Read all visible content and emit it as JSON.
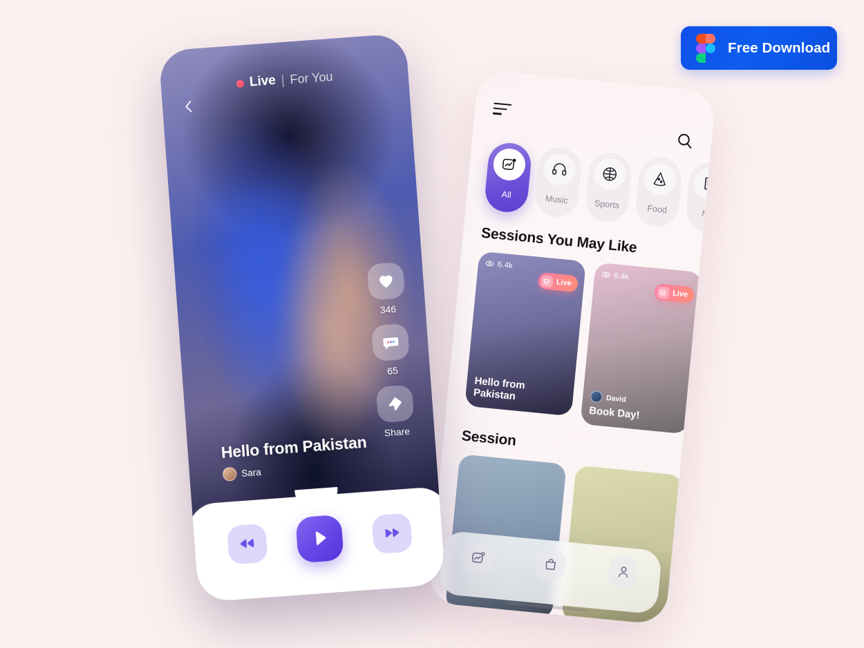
{
  "download": {
    "label": "Free Download",
    "icon": "figma-logo",
    "accent": "#1050e8"
  },
  "theme": {
    "background": "#fdf1f0",
    "purple": "#6546e6",
    "purple_light": "#dcd8fa",
    "live_pink": "#fb7fa6",
    "phone_header": "#8e8cbd"
  },
  "live_screen": {
    "back_icon": "chevron-left-icon",
    "status_dot": "live-dot",
    "title_live": "Live",
    "title_separator": "|",
    "title_feed": "For You",
    "actions": [
      {
        "icon": "heart-icon",
        "label": "346",
        "name": "like-action"
      },
      {
        "icon": "comment-icon",
        "label": "65",
        "name": "comment-action"
      },
      {
        "icon": "share-icon",
        "label": "Share",
        "name": "share-action"
      }
    ],
    "caption": "Hello from Pakistan",
    "user": "Sara",
    "player": {
      "rewind_icon": "rewind-icon",
      "play_icon": "play-icon",
      "forward_icon": "forward-icon"
    }
  },
  "home_screen": {
    "menu_icon": "hamburger-icon",
    "search_icon": "search-icon",
    "categories": [
      {
        "label": "All",
        "icon": "photo-chart-icon",
        "active": true
      },
      {
        "label": "Music",
        "icon": "headphones-icon",
        "active": false
      },
      {
        "label": "Sports",
        "icon": "basketball-icon",
        "active": false
      },
      {
        "label": "Food",
        "icon": "pizza-icon",
        "active": false
      },
      {
        "label": "Ne",
        "icon": "news-icon",
        "active": false
      }
    ],
    "sections": [
      {
        "title": "Sessions You May Like",
        "cards": [
          {
            "views": "6.4k",
            "badge": "Live",
            "user": "",
            "caption": "Hello from Pakistan"
          },
          {
            "views": "6.4k",
            "badge": "Live",
            "user": "David",
            "caption": "Book Day!"
          }
        ]
      },
      {
        "title": "Session",
        "cards": [
          {
            "views": "",
            "badge": "",
            "user": "",
            "caption": ""
          },
          {
            "views": "",
            "badge": "",
            "user": "",
            "caption": ""
          }
        ]
      }
    ],
    "tabs": [
      {
        "icon": "photo-chart-icon",
        "name": "tab-sessions"
      },
      {
        "icon": "bag-icon",
        "name": "tab-shop"
      },
      {
        "icon": "person-icon",
        "name": "tab-profile"
      }
    ]
  }
}
